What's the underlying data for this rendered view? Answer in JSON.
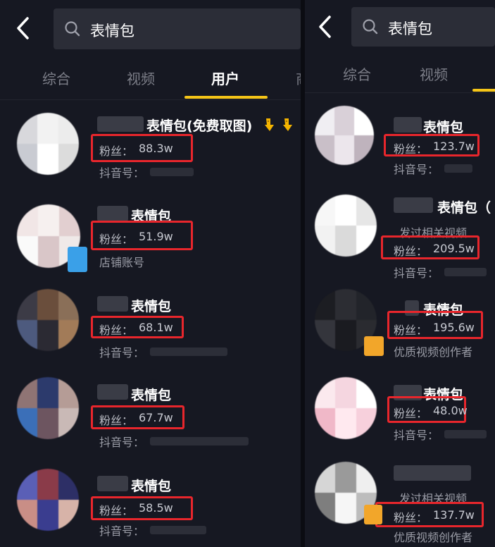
{
  "search": {
    "query": "表情包"
  },
  "tabs": [
    "综合",
    "视频",
    "用户",
    "商"
  ],
  "active_tab": "用户",
  "keyword": "表情包",
  "fans_prefix": "粉丝：",
  "id_prefix": "抖音号：",
  "left_results": [
    {
      "name": "表情包(免费取图)",
      "fans": "88.3w",
      "meta": "抖音号：",
      "avatar_colors": [
        "#d8d8dc",
        "#f2f2f2",
        "#ececec",
        "#c9cbd2",
        "#ffffff",
        "#dcdcdc"
      ]
    },
    {
      "name": "表情包",
      "fans": "51.9w",
      "meta": "店铺账号",
      "avatar_colors": [
        "#f1e6e6",
        "#f6f0ef",
        "#e2cfd0",
        "#fafafa",
        "#d9c6c8",
        "#efe9e8"
      ]
    },
    {
      "name": "表情包",
      "fans": "68.1w",
      "meta": "抖音号：",
      "avatar_colors": [
        "#3c3b46",
        "#6a4e3c",
        "#8a6f58",
        "#4d5a7e",
        "#2b2a33",
        "#a27b58"
      ]
    },
    {
      "name": "表情包",
      "fans": "67.7w",
      "meta": "抖音号：",
      "avatar_colors": [
        "#8f7474",
        "#2c3a6c",
        "#b59c96",
        "#3b6fb8",
        "#6d5560",
        "#c9b9b6"
      ]
    },
    {
      "name": "表情包",
      "fans": "58.5w",
      "meta": "抖音号：",
      "avatar_colors": [
        "#5a5fb6",
        "#8a3b49",
        "#2d2f66",
        "#c98e86",
        "#3a3d8f",
        "#d7b3a8"
      ]
    }
  ],
  "right_results": [
    {
      "name": "表情包",
      "fans": "123.7w",
      "meta": "抖音号：",
      "extra": "",
      "avatar_colors": [
        "#f0eef2",
        "#d9d0d8",
        "#ffffff",
        "#c9bfc8",
        "#ece6ec",
        "#bfb3bd"
      ]
    },
    {
      "name": "表情包（",
      "fans": "209.5w",
      "meta": "抖音号：",
      "extra": "发过相关视频",
      "avatar_colors": [
        "#f7f7f7",
        "#ffffff",
        "#e6e6e6",
        "#f2f2f2",
        "#dadada",
        "#ffffff"
      ]
    },
    {
      "name": "表情包",
      "fans": "195.6w",
      "meta": "优质视频创作者",
      "extra": "",
      "avatar_colors": [
        "#1c1d22",
        "#2c2d33",
        "#22242a",
        "#34353c",
        "#1a1b20",
        "#2a2b30"
      ]
    },
    {
      "name": "表情包",
      "fans": "48.0w",
      "meta": "抖音号：",
      "extra": "",
      "avatar_colors": [
        "#fbe9ee",
        "#f5d6e0",
        "#ffffff",
        "#f0b8c8",
        "#ffe9ef",
        "#f7d0dc"
      ]
    },
    {
      "name": "",
      "fans": "137.7w",
      "meta": "优质视频创作者",
      "extra": "发过相关视频",
      "avatar_colors": [
        "#d6d6d6",
        "#9a9a9a",
        "#efefef",
        "#7e7e7e",
        "#f6f6f6",
        "#bcbcbc"
      ]
    }
  ]
}
